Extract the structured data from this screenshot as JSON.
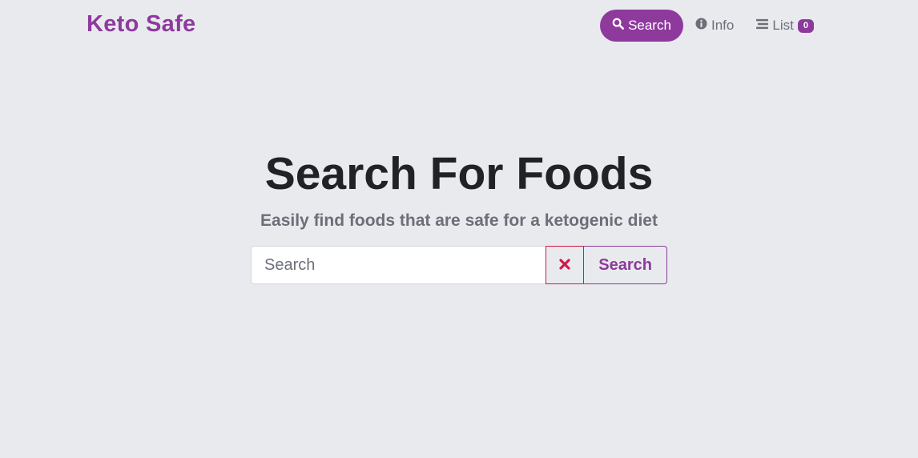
{
  "brand": {
    "name": "Keto Safe"
  },
  "nav": {
    "items": [
      {
        "label": "Search",
        "icon": "search-icon",
        "active": true
      },
      {
        "label": "Info",
        "icon": "info-icon",
        "active": false
      },
      {
        "label": "List",
        "icon": "list-icon",
        "active": false,
        "badge": "0"
      }
    ]
  },
  "hero": {
    "title": "Search For Foods",
    "subtitle": "Easily find foods that are safe for a ketogenic diet"
  },
  "search": {
    "placeholder": "Search",
    "value": "",
    "clear_icon": "close-icon",
    "button_label": "Search"
  },
  "colors": {
    "background": "#e9eaee",
    "accent": "#8e3a9d",
    "danger": "#d11a4a",
    "heading": "#212226",
    "muted": "#6c6f78"
  }
}
